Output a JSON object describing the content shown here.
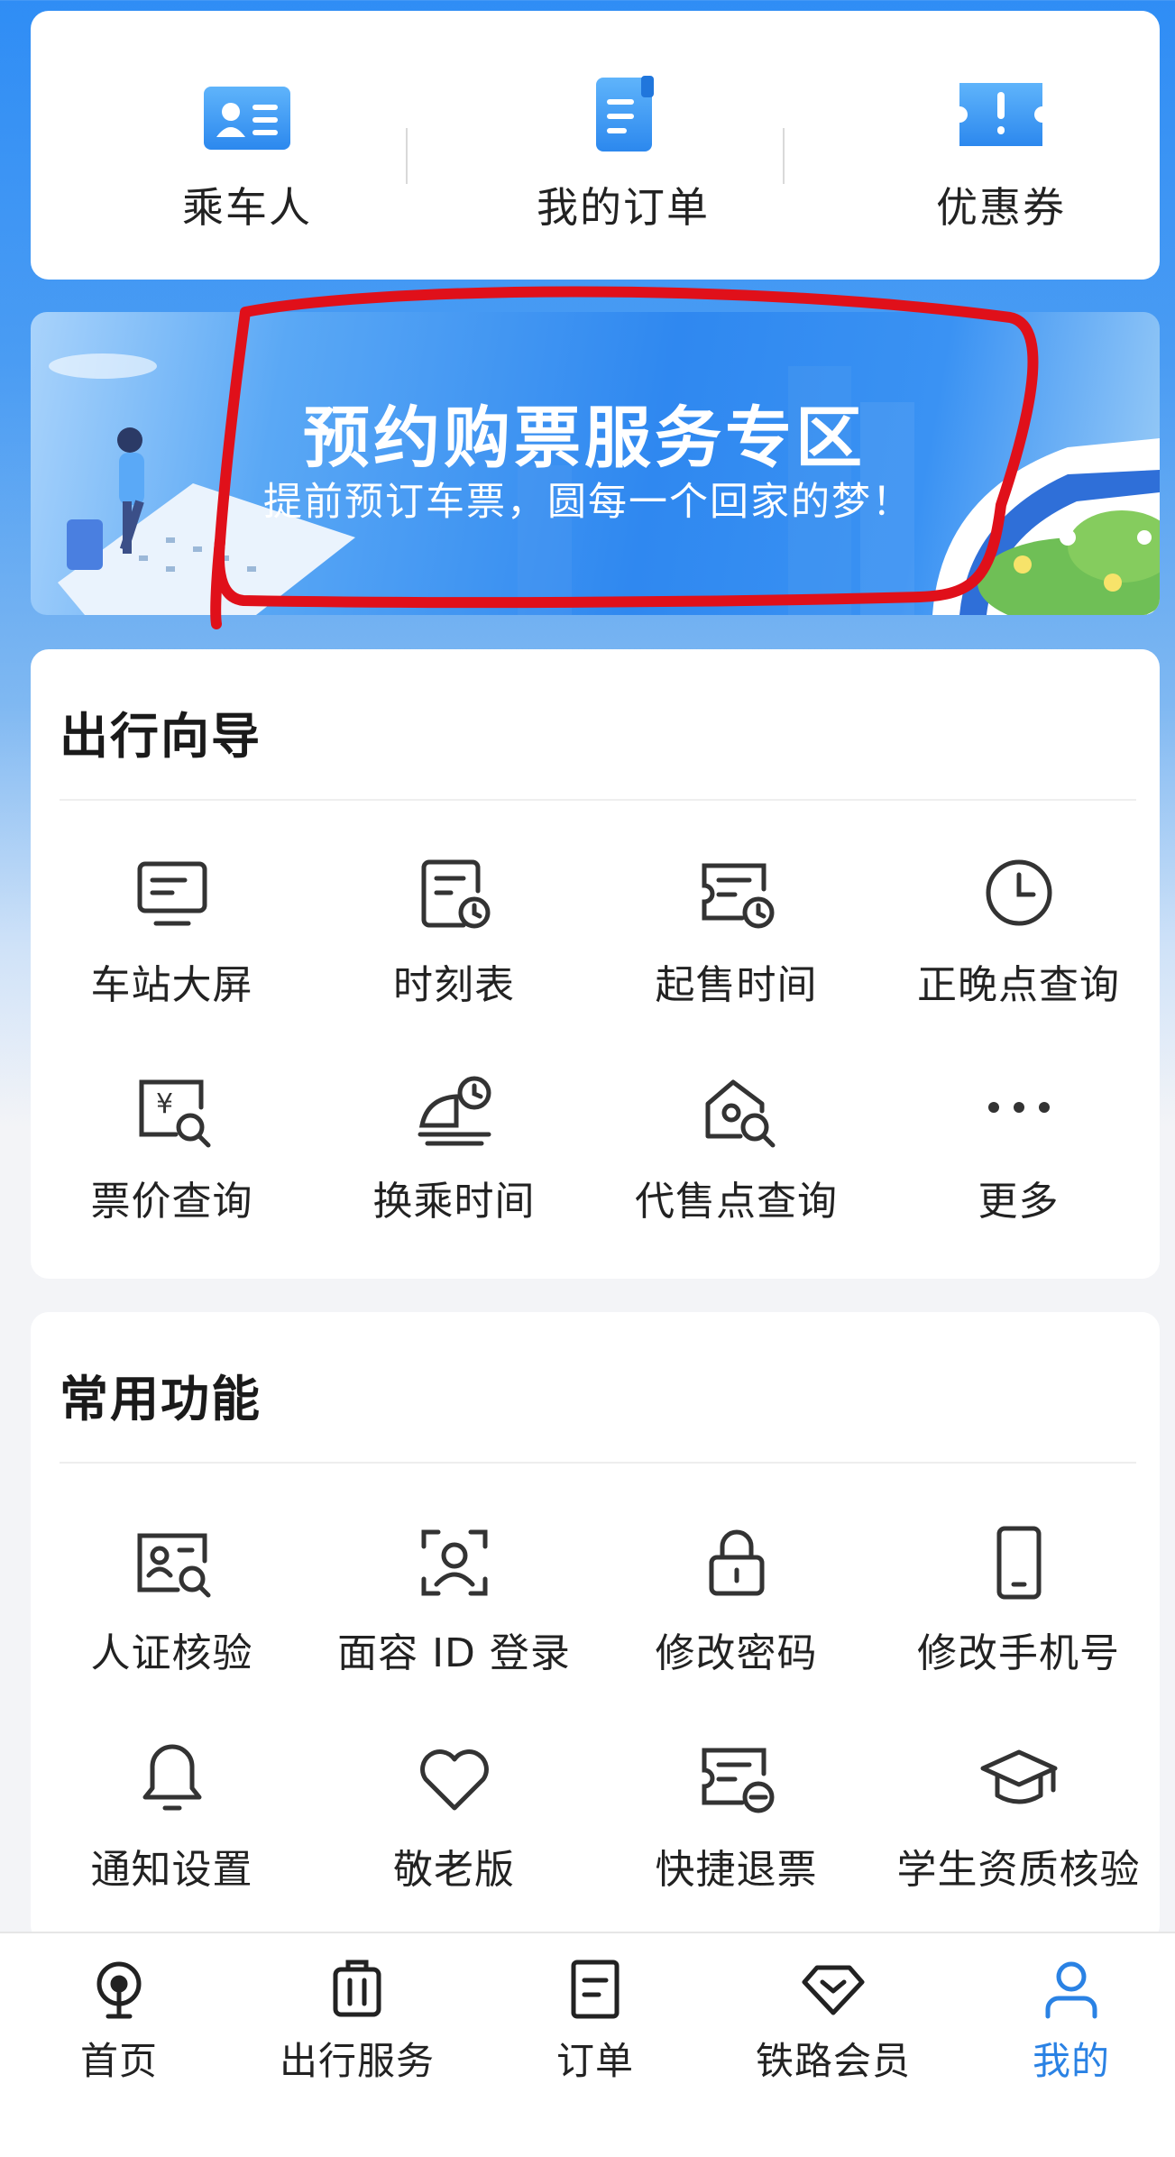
{
  "quick_actions": [
    {
      "label": "乘车人",
      "icon": "passenger-card-icon"
    },
    {
      "label": "我的订单",
      "icon": "order-doc-icon"
    },
    {
      "label": "优惠券",
      "icon": "coupon-icon"
    }
  ],
  "banner": {
    "title": "预约购票服务专区",
    "subtitle": "提前预订车票，圆每一个回家的梦！"
  },
  "travel_guide": {
    "title": "出行向导",
    "items": [
      {
        "label": "车站大屏",
        "icon": "station-screen-icon"
      },
      {
        "label": "时刻表",
        "icon": "timetable-icon"
      },
      {
        "label": "起售时间",
        "icon": "sale-time-icon"
      },
      {
        "label": "正晚点查询",
        "icon": "clock-icon"
      },
      {
        "label": "票价查询",
        "icon": "fare-search-icon"
      },
      {
        "label": "换乘时间",
        "icon": "transfer-time-icon"
      },
      {
        "label": "代售点查询",
        "icon": "agency-search-icon"
      },
      {
        "label": "更多",
        "icon": "more-dots-icon"
      }
    ]
  },
  "common_functions": {
    "title": "常用功能",
    "items": [
      {
        "label": "人证核验",
        "icon": "id-verify-icon"
      },
      {
        "label": "面容 ID 登录",
        "icon": "face-id-icon"
      },
      {
        "label": "修改密码",
        "icon": "lock-icon"
      },
      {
        "label": "修改手机号",
        "icon": "phone-icon"
      },
      {
        "label": "通知设置",
        "icon": "bell-icon"
      },
      {
        "label": "敬老版",
        "icon": "heart-icon"
      },
      {
        "label": "快捷退票",
        "icon": "refund-ticket-icon"
      },
      {
        "label": "学生资质核验",
        "icon": "graduation-cap-icon"
      }
    ]
  },
  "bottom_nav": [
    {
      "label": "首页",
      "icon": "train-home-icon",
      "active": false
    },
    {
      "label": "出行服务",
      "icon": "luggage-icon",
      "active": false
    },
    {
      "label": "订单",
      "icon": "order-icon",
      "active": false
    },
    {
      "label": "铁路会员",
      "icon": "diamond-icon",
      "active": false
    },
    {
      "label": "我的",
      "icon": "user-icon",
      "active": true
    }
  ],
  "colors": {
    "accent": "#2a82e4",
    "annotation": "#e0101a",
    "icon_blue": "#3d9cf4"
  }
}
